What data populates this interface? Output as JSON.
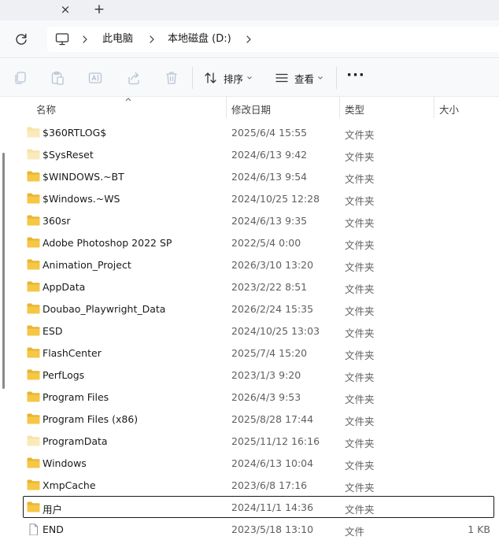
{
  "tabs": {
    "close_glyph": "×",
    "new_glyph": "+"
  },
  "address": {
    "crumbs": [
      "此电脑",
      "本地磁盘 (D:)"
    ]
  },
  "toolbar": {
    "sort_label": "排序",
    "view_label": "查看",
    "more_glyph": "···",
    "icons": [
      "copy-icon",
      "paste-icon",
      "rename-icon",
      "share-icon",
      "delete-icon",
      "sort-icon",
      "view-icon"
    ]
  },
  "columns": {
    "name": "名称",
    "date": "修改日期",
    "type": "类型",
    "size": "大小"
  },
  "colors": {
    "folder": "#f4c542",
    "folder_light": "#f8de8a",
    "selected_border": "#1a1a1a"
  },
  "files": [
    {
      "name": "$360RTLOG$",
      "date": "2025/6/4 15:55",
      "type": "文件夹",
      "size": "",
      "kind": "folder-faded"
    },
    {
      "name": "$SysReset",
      "date": "2024/6/13 9:42",
      "type": "文件夹",
      "size": "",
      "kind": "folder-faded"
    },
    {
      "name": "$WINDOWS.~BT",
      "date": "2024/6/13 9:54",
      "type": "文件夹",
      "size": "",
      "kind": "folder"
    },
    {
      "name": "$Windows.~WS",
      "date": "2024/10/25 12:28",
      "type": "文件夹",
      "size": "",
      "kind": "folder"
    },
    {
      "name": "360sr",
      "date": "2024/6/13 9:35",
      "type": "文件夹",
      "size": "",
      "kind": "folder"
    },
    {
      "name": "Adobe Photoshop 2022 SP",
      "date": "2022/5/4 0:00",
      "type": "文件夹",
      "size": "",
      "kind": "folder"
    },
    {
      "name": "Animation_Project",
      "date": "2026/3/10 13:20",
      "type": "文件夹",
      "size": "",
      "kind": "folder"
    },
    {
      "name": "AppData",
      "date": "2023/2/22 8:51",
      "type": "文件夹",
      "size": "",
      "kind": "folder"
    },
    {
      "name": "Doubao_Playwright_Data",
      "date": "2026/2/24 15:35",
      "type": "文件夹",
      "size": "",
      "kind": "folder"
    },
    {
      "name": "ESD",
      "date": "2024/10/25 13:03",
      "type": "文件夹",
      "size": "",
      "kind": "folder"
    },
    {
      "name": "FlashCenter",
      "date": "2025/7/4 15:20",
      "type": "文件夹",
      "size": "",
      "kind": "folder"
    },
    {
      "name": "PerfLogs",
      "date": "2023/1/3 9:20",
      "type": "文件夹",
      "size": "",
      "kind": "folder"
    },
    {
      "name": "Program Files",
      "date": "2026/4/3 9:53",
      "type": "文件夹",
      "size": "",
      "kind": "folder"
    },
    {
      "name": "Program Files (x86)",
      "date": "2025/8/28 17:44",
      "type": "文件夹",
      "size": "",
      "kind": "folder"
    },
    {
      "name": "ProgramData",
      "date": "2025/11/12 16:16",
      "type": "文件夹",
      "size": "",
      "kind": "folder-faded"
    },
    {
      "name": "Windows",
      "date": "2024/6/13 10:04",
      "type": "文件夹",
      "size": "",
      "kind": "folder"
    },
    {
      "name": "XmpCache",
      "date": "2023/6/8 17:16",
      "type": "文件夹",
      "size": "",
      "kind": "folder"
    },
    {
      "name": "用户",
      "date": "2024/11/1 14:36",
      "type": "文件夹",
      "size": "",
      "kind": "folder",
      "selected": true
    },
    {
      "name": "END",
      "date": "2023/5/18 13:10",
      "type": "文件",
      "size": "1 KB",
      "kind": "file"
    }
  ]
}
